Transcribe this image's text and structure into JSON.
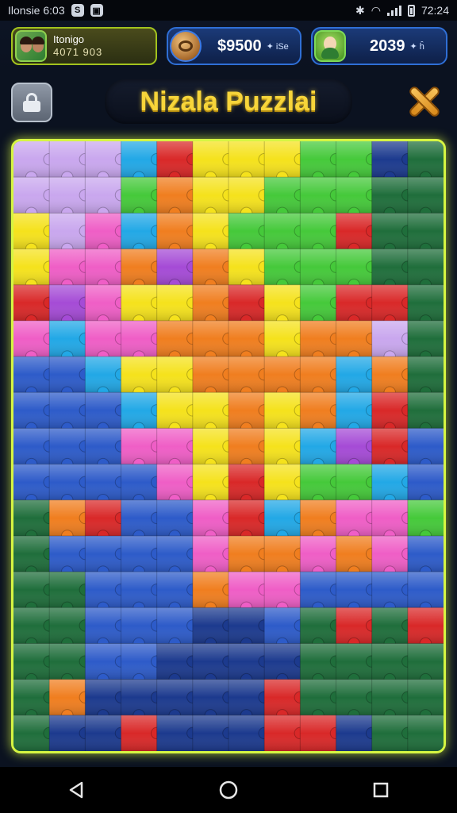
{
  "status_bar": {
    "left_text": "Ilonsie 6:03",
    "clock": "72:24"
  },
  "player": {
    "name": "Itonigo",
    "score": "4071 903",
    "avatar_icon": "player-avatar"
  },
  "coins": {
    "value": "$9500",
    "suffix": "✦ iSe",
    "icon": "coin-icon"
  },
  "gems": {
    "value": "2039",
    "suffix": "✦ ĥ",
    "icon": "character-icon"
  },
  "title": {
    "text": "Nizala Puzzlai"
  },
  "buttons": {
    "lock_icon": "lock-icon",
    "close_icon": "close-icon"
  },
  "board": {
    "cols": 12,
    "rows": 17,
    "frame_color": "#d6f542",
    "palette": {
      "L": "#c9a7ee",
      "Y": "#f5e21c",
      "O": "#f07e1f",
      "R": "#d92828",
      "P": "#ef5ec6",
      "M": "#a54bd6",
      "C": "#22a8e6",
      "G": "#45c93a",
      "D": "#1f6e3b",
      "B": "#2d5bc9",
      "N": "#1c3a8e",
      "K": "#163a3a"
    },
    "grid": [
      "LLLCRYYYGGND",
      "LLLGOYYGGGDD",
      "YLPCOYGGGRDD",
      "YPPOMOYGGGDD",
      "RMPYYORYGRRD",
      "PCPPOOOYOOLD",
      "BBCYYOOOOCOD",
      "BBBCYYOYOCRD",
      "BBBPPYOYCMRB",
      "BBBBPYRYGGCB",
      "DORBBPRCOPPG",
      "DBBBBPOOPOPB",
      "DDBBBOPPBBBB",
      "DDBBBNNBDRDR",
      "DDBBNNNNDDDD",
      "DONNNNNRDDDD",
      "DNNRNNNRRNDD"
    ]
  },
  "nav": {
    "back_icon": "back-icon",
    "home_icon": "home-icon",
    "recents_icon": "recents-icon"
  }
}
